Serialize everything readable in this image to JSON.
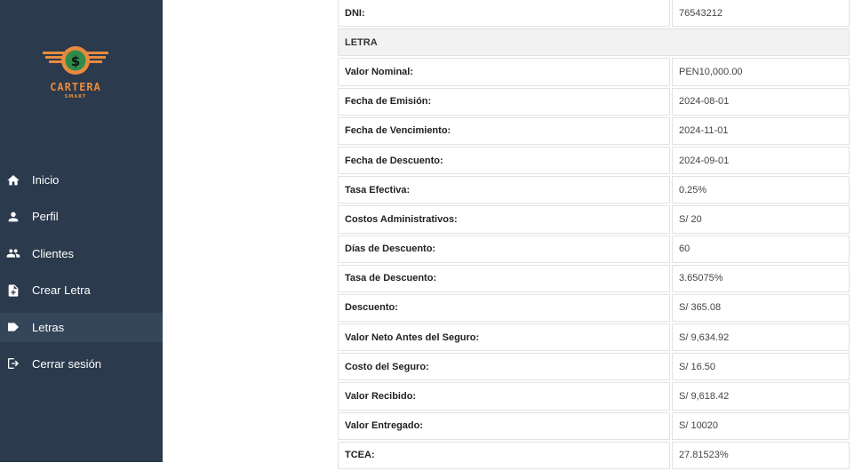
{
  "app": {
    "brand": "CARTERA",
    "brand_sub": "SMART",
    "colors": {
      "sidebar_bg": "#2b3a4c",
      "sidebar_active": "#34465a",
      "brand_orange": "#e88a3d"
    }
  },
  "sidebar": {
    "items": [
      {
        "label": "Inicio",
        "icon": "home-icon"
      },
      {
        "label": "Perfil",
        "icon": "person-icon"
      },
      {
        "label": "Clientes",
        "icon": "people-icon"
      },
      {
        "label": "Crear Letra",
        "icon": "file-plus-icon"
      },
      {
        "label": "Letras",
        "icon": "label-icon",
        "active": true
      },
      {
        "label": "Cerrar sesión",
        "icon": "logout-icon"
      }
    ]
  },
  "details": {
    "dni": {
      "label": "DNI:",
      "value": "76543212"
    },
    "section_letra": "LETRA",
    "rows": [
      {
        "label": "Valor Nominal:",
        "value": "PEN10,000.00"
      },
      {
        "label": "Fecha de Emisión:",
        "value": "2024-08-01"
      },
      {
        "label": "Fecha de Vencimiento:",
        "value": "2024-11-01"
      },
      {
        "label": "Fecha de Descuento:",
        "value": "2024-09-01"
      },
      {
        "label": "Tasa Efectiva:",
        "value": "0.25%"
      },
      {
        "label": "Costos Administrativos:",
        "value": "S/ 20"
      },
      {
        "label": "Días de Descuento:",
        "value": "60"
      },
      {
        "label": "Tasa de Descuento:",
        "value": "3.65075%"
      },
      {
        "label": "Descuento:",
        "value": "S/ 365.08"
      },
      {
        "label": "Valor Neto Antes del Seguro:",
        "value": "S/ 9,634.92"
      },
      {
        "label": "Costo del Seguro:",
        "value": "S/ 16.50"
      },
      {
        "label": "Valor Recibido:",
        "value": "S/ 9,618.42"
      },
      {
        "label": "Valor Entregado:",
        "value": "S/ 10020"
      },
      {
        "label": "TCEA:",
        "value": "27.81523%"
      }
    ]
  }
}
